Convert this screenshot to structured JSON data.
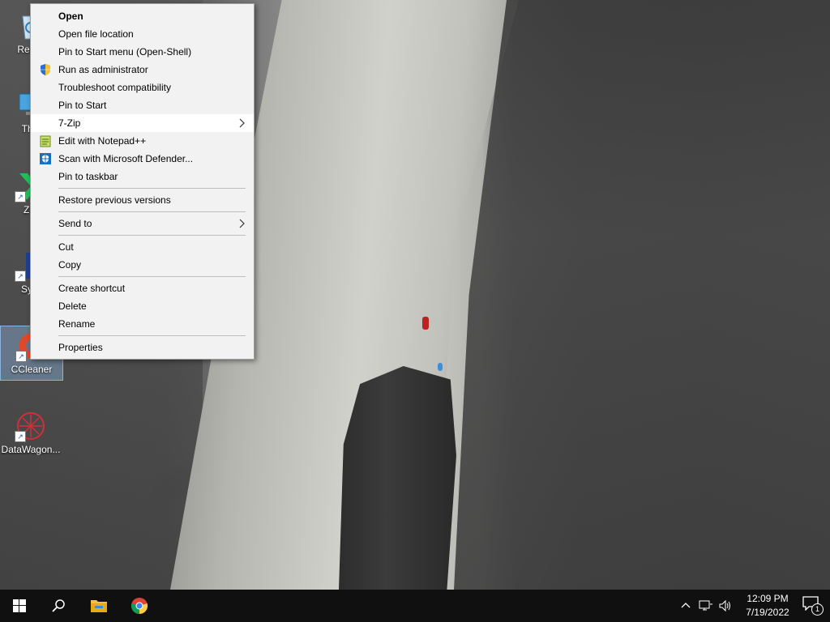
{
  "desktop": {
    "icons": [
      {
        "label": "Recyc",
        "icon": "recycle-bin-icon"
      },
      {
        "label": "This",
        "icon": "this-pc-icon"
      },
      {
        "label": "Zer",
        "icon": "zero-app-icon"
      },
      {
        "label": "Synt",
        "icon": "synth-app-icon"
      },
      {
        "label": "CCleaner",
        "icon": "ccleaner-icon"
      },
      {
        "label": "DataWagon...",
        "icon": "datawagon-icon"
      }
    ]
  },
  "context_menu": {
    "items": [
      {
        "label": "Open",
        "bold": true
      },
      {
        "label": "Open file location"
      },
      {
        "label": "Pin to Start menu (Open-Shell)"
      },
      {
        "label": "Run as administrator",
        "icon": "uac-shield-icon"
      },
      {
        "label": "Troubleshoot compatibility"
      },
      {
        "label": "Pin to Start"
      },
      {
        "label": "7-Zip",
        "submenu": true,
        "highlighted": true
      },
      {
        "label": "Edit with Notepad++",
        "icon": "notepad-plus-plus-icon"
      },
      {
        "label": "Scan with Microsoft Defender...",
        "icon": "defender-icon"
      },
      {
        "label": "Pin to taskbar"
      },
      {
        "label": "Restore previous versions"
      },
      {
        "label": "Send to",
        "submenu": true
      },
      {
        "label": "Cut"
      },
      {
        "label": "Copy"
      },
      {
        "label": "Create shortcut"
      },
      {
        "label": "Delete"
      },
      {
        "label": "Rename"
      },
      {
        "label": "Properties"
      }
    ],
    "submenu_arrow": ">"
  },
  "taskbar": {
    "start": "windows-start-icon",
    "search": "search-icon",
    "pinned": [
      "file-explorer-icon",
      "chrome-icon"
    ],
    "tray": {
      "chevron": "^",
      "network": "network-icon",
      "volume": "volume-icon",
      "time": "12:09 PM",
      "date": "7/19/2022",
      "notification_count": "1"
    }
  },
  "colors": {
    "menu_bg": "#f2f2f2",
    "menu_highlight": "#ffffff",
    "taskbar_bg": "#101010",
    "selection": "#99ccff"
  }
}
